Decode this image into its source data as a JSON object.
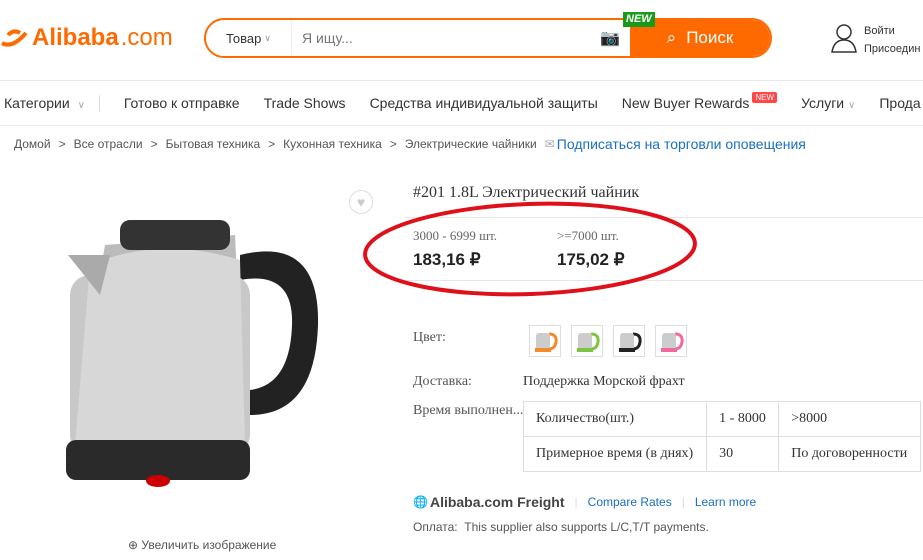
{
  "header": {
    "logo": "Alibaba",
    "logo_suffix": ".com",
    "search_category": "Товар",
    "search_placeholder": "Я ищу...",
    "search_button": "Поиск",
    "new_badge": "NEW",
    "sign_in": "Войти",
    "join": "Присоедин"
  },
  "nav": {
    "items": [
      "Категории",
      "Готово к отправке",
      "Trade Shows",
      "Средства индивидуальной защиты",
      "New Buyer Rewards",
      "Услуги",
      "Прода"
    ],
    "new_badge": "NEW"
  },
  "breadcrumb": {
    "items": [
      "Домой",
      "Все отрасли",
      "Бытовая техника",
      "Кухонная техника",
      "Электрические чайники"
    ],
    "subscribe": "Подписаться на торговли оповещения"
  },
  "product": {
    "title": "#201 1.8L Электрический чайник",
    "prices": [
      {
        "qty": "3000 - 6999 шт.",
        "price": "183,16 ₽"
      },
      {
        "qty": ">=7000 шт.",
        "price": "175,02 ₽"
      }
    ],
    "color_label": "Цвет:",
    "colors": [
      "#f08a2a",
      "#7cc443",
      "#222222",
      "#f06aa0"
    ],
    "shipping_label": "Доставка:",
    "shipping_value": "Поддержка Морской фрахт",
    "lead_label": "Время выполнен...",
    "lead_table": [
      [
        "Количество(шт.)",
        "1 - 8000",
        ">8000"
      ],
      [
        "Примерное время (в днях)",
        "30",
        "По договоренности"
      ]
    ],
    "freight": "Alibaba.com Freight",
    "compare": "Compare Rates",
    "learn": "Learn more",
    "payment_label": "Оплата:",
    "payment_text": "This supplier also supports L/C,T/T payments.",
    "zoom_image": "Увеличить изображение"
  },
  "annotation_color": "#e0101a"
}
